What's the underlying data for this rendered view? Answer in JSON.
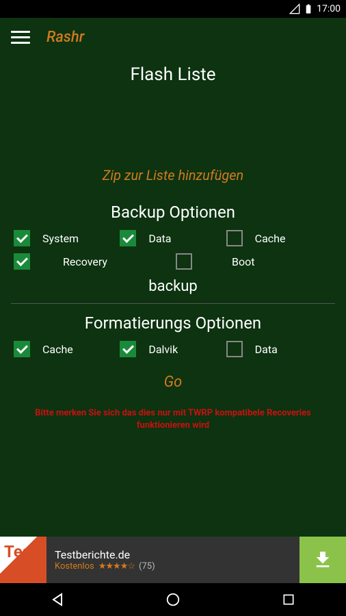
{
  "statusBar": {
    "time": "17:00"
  },
  "appBar": {
    "title": "Rashr"
  },
  "page": {
    "title": "Flash Liste",
    "addZip": "Zip zur Liste hinzufügen",
    "backupSection": {
      "title": "Backup Optionen",
      "options": {
        "system": {
          "label": "System",
          "checked": true
        },
        "data": {
          "label": "Data",
          "checked": true
        },
        "cache": {
          "label": "Cache",
          "checked": false
        },
        "recovery": {
          "label": "Recovery",
          "checked": true
        },
        "boot": {
          "label": "Boot",
          "checked": false
        }
      },
      "folderLabel": "backup"
    },
    "formatSection": {
      "title": "Formatierungs Optionen",
      "options": {
        "cache": {
          "label": "Cache",
          "checked": true
        },
        "dalvik": {
          "label": "Dalvik",
          "checked": true
        },
        "data": {
          "label": "Data",
          "checked": false
        }
      }
    },
    "goButton": "Go",
    "warning": "Bitte merken Sie sich das dies nur mit TWRP kompatibele Recoveries funktionieren wird"
  },
  "ad": {
    "iconText": "Tes",
    "title": "Testberichte.de",
    "price": "Kostenlos",
    "stars": "★★★★☆",
    "count": "(75)"
  }
}
